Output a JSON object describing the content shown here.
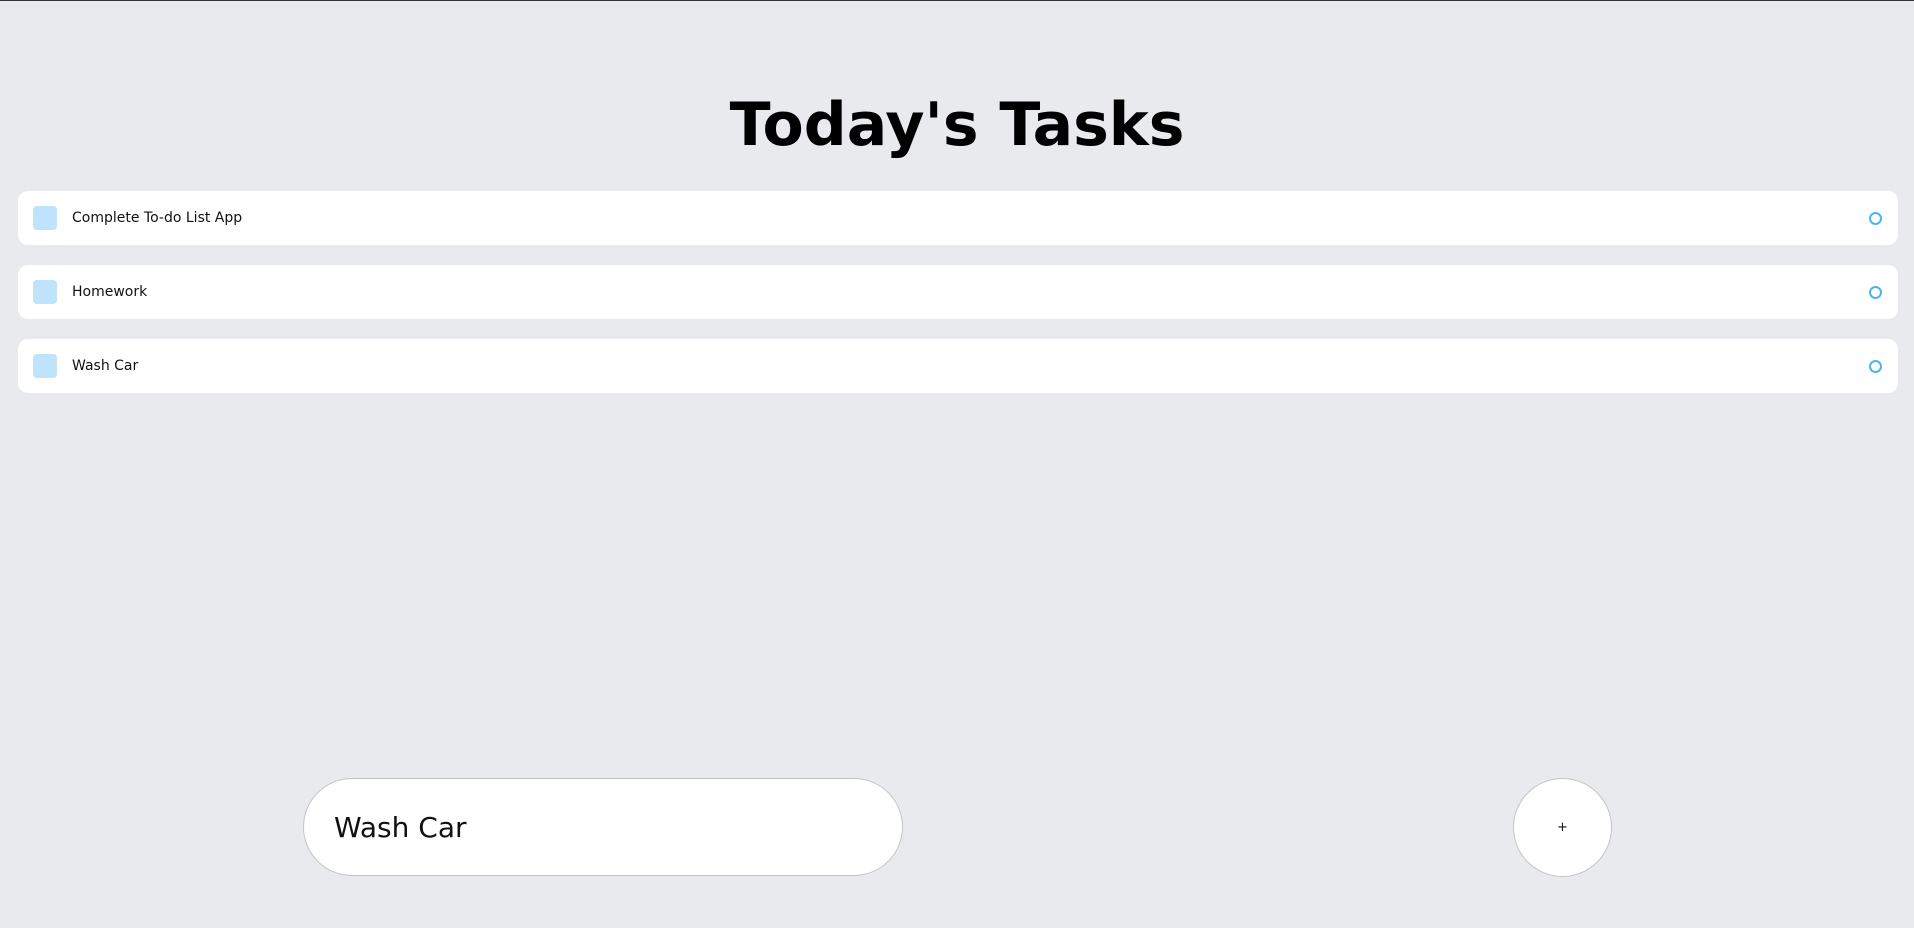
{
  "header": {
    "title": "Today's Tasks"
  },
  "tasks": [
    {
      "label": "Complete To-do List App",
      "completed": false
    },
    {
      "label": "Homework",
      "completed": false
    },
    {
      "label": "Wash Car",
      "completed": false
    }
  ],
  "input": {
    "value": "Wash Car"
  },
  "add_button": {
    "label": "+"
  },
  "colors": {
    "background": "#e8eaed",
    "checkbox": "#bfe3fa",
    "status_circle": "#4db5ec"
  },
  "icons": {
    "status": "circle-outline-icon"
  }
}
